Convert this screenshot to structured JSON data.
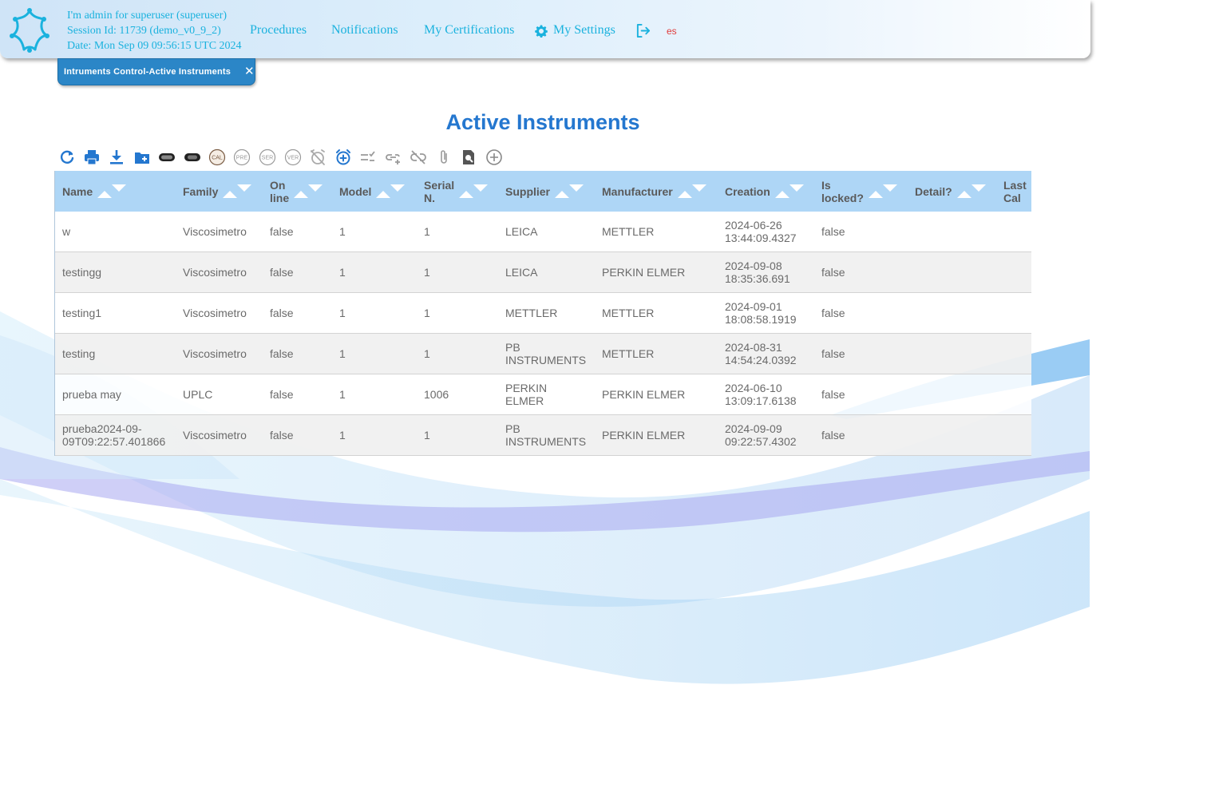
{
  "header": {
    "session_line1": "I'm admin for superuser (superuser)",
    "session_line2": "Session Id: 11739 (demo_v0_9_2)",
    "session_line3": "Date: Mon Sep 09 09:56:15 UTC 2024",
    "nav": {
      "procedures": "Procedures",
      "notifications": "Notifications",
      "certifications": "My Certifications",
      "settings": "My Settings"
    },
    "language": "es"
  },
  "tab": {
    "label": "Intruments Control-Active Instruments",
    "close": "✕"
  },
  "page": {
    "title": "Active Instruments"
  },
  "toolbar": {
    "icons": [
      "refresh-icon",
      "print-icon",
      "download-icon",
      "new-folder-icon",
      "toggle-icon",
      "toggle-icon",
      "cal-icon",
      "pre-icon",
      "ser-icon",
      "ver-icon",
      "alarm-off-icon",
      "alarm-add-icon",
      "checklist-icon",
      "link-add-icon",
      "link-off-icon",
      "attachment-icon",
      "document-search-icon",
      "add-circle-icon"
    ],
    "cal": "CAL",
    "pre": "PRE",
    "ser": "SER",
    "ver": "VER"
  },
  "colors": {
    "accent": "#2477cf",
    "header_link": "#1ab2de",
    "table_header": "#aed6f6",
    "tab": "#2b86c7"
  },
  "table": {
    "columns": [
      {
        "line1": "Name",
        "line2": ""
      },
      {
        "line1": "Family",
        "line2": ""
      },
      {
        "line1": "On",
        "line2": "line"
      },
      {
        "line1": "Model",
        "line2": ""
      },
      {
        "line1": "Serial",
        "line2": "N."
      },
      {
        "line1": "Supplier",
        "line2": ""
      },
      {
        "line1": "Manufacturer",
        "line2": ""
      },
      {
        "line1": "Creation",
        "line2": ""
      },
      {
        "line1": "Is",
        "line2": "locked?"
      },
      {
        "line1": "Detail?",
        "line2": ""
      },
      {
        "line1": "Last",
        "line2": "Cal"
      }
    ],
    "rows": [
      {
        "name": [
          "w",
          ""
        ],
        "family": "Viscosimetro",
        "online": "false",
        "model": "1",
        "serial": "1",
        "supplier": [
          "LEICA",
          ""
        ],
        "manufacturer": "METTLER",
        "creation": [
          "2024-06-26",
          "13:44:09.4327"
        ],
        "locked": "false",
        "detail": "",
        "lastcal": ""
      },
      {
        "name": [
          "testingg",
          ""
        ],
        "family": "Viscosimetro",
        "online": "false",
        "model": "1",
        "serial": "1",
        "supplier": [
          "LEICA",
          ""
        ],
        "manufacturer": "PERKIN ELMER",
        "creation": [
          "2024-09-08",
          "18:35:36.691"
        ],
        "locked": "false",
        "detail": "",
        "lastcal": ""
      },
      {
        "name": [
          "testing1",
          ""
        ],
        "family": "Viscosimetro",
        "online": "false",
        "model": "1",
        "serial": "1",
        "supplier": [
          "METTLER",
          ""
        ],
        "manufacturer": "METTLER",
        "creation": [
          "2024-09-01",
          "18:08:58.1919"
        ],
        "locked": "false",
        "detail": "",
        "lastcal": ""
      },
      {
        "name": [
          "testing",
          ""
        ],
        "family": "Viscosimetro",
        "online": "false",
        "model": "1",
        "serial": "1",
        "supplier": [
          "PB",
          "INSTRUMENTS"
        ],
        "manufacturer": "METTLER",
        "creation": [
          "2024-08-31",
          "14:54:24.0392"
        ],
        "locked": "false",
        "detail": "",
        "lastcal": ""
      },
      {
        "name": [
          "prueba may",
          ""
        ],
        "family": "UPLC",
        "online": "false",
        "model": "1",
        "serial": "1006",
        "supplier": [
          "PERKIN",
          "ELMER"
        ],
        "manufacturer": "PERKIN ELMER",
        "creation": [
          "2024-06-10",
          "13:09:17.6138"
        ],
        "locked": "false",
        "detail": "",
        "lastcal": ""
      },
      {
        "name": [
          "prueba2024-09-",
          "09T09:22:57.401866"
        ],
        "family": "Viscosimetro",
        "online": "false",
        "model": "1",
        "serial": "1",
        "supplier": [
          "PB",
          "INSTRUMENTS"
        ],
        "manufacturer": "PERKIN ELMER",
        "creation": [
          "2024-09-09",
          "09:22:57.4302"
        ],
        "locked": "false",
        "detail": "",
        "lastcal": ""
      }
    ]
  }
}
